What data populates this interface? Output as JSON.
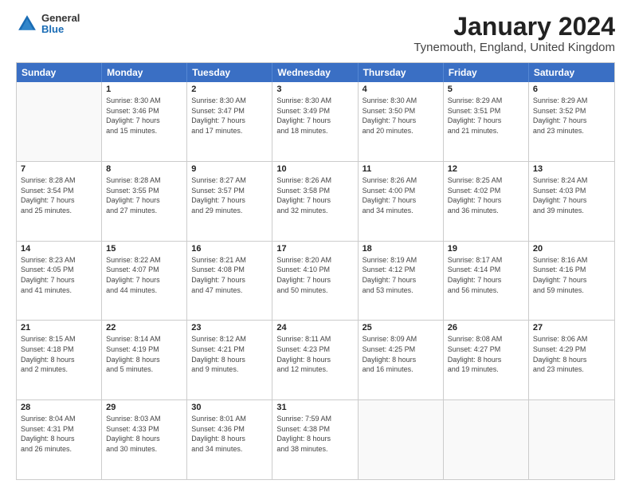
{
  "logo": {
    "general": "General",
    "blue": "Blue"
  },
  "title": "January 2024",
  "location": "Tynemouth, England, United Kingdom",
  "days_of_week": [
    "Sunday",
    "Monday",
    "Tuesday",
    "Wednesday",
    "Thursday",
    "Friday",
    "Saturday"
  ],
  "weeks": [
    [
      {
        "day": "",
        "info": ""
      },
      {
        "day": "1",
        "info": "Sunrise: 8:30 AM\nSunset: 3:46 PM\nDaylight: 7 hours\nand 15 minutes."
      },
      {
        "day": "2",
        "info": "Sunrise: 8:30 AM\nSunset: 3:47 PM\nDaylight: 7 hours\nand 17 minutes."
      },
      {
        "day": "3",
        "info": "Sunrise: 8:30 AM\nSunset: 3:49 PM\nDaylight: 7 hours\nand 18 minutes."
      },
      {
        "day": "4",
        "info": "Sunrise: 8:30 AM\nSunset: 3:50 PM\nDaylight: 7 hours\nand 20 minutes."
      },
      {
        "day": "5",
        "info": "Sunrise: 8:29 AM\nSunset: 3:51 PM\nDaylight: 7 hours\nand 21 minutes."
      },
      {
        "day": "6",
        "info": "Sunrise: 8:29 AM\nSunset: 3:52 PM\nDaylight: 7 hours\nand 23 minutes."
      }
    ],
    [
      {
        "day": "7",
        "info": "Sunrise: 8:28 AM\nSunset: 3:54 PM\nDaylight: 7 hours\nand 25 minutes."
      },
      {
        "day": "8",
        "info": "Sunrise: 8:28 AM\nSunset: 3:55 PM\nDaylight: 7 hours\nand 27 minutes."
      },
      {
        "day": "9",
        "info": "Sunrise: 8:27 AM\nSunset: 3:57 PM\nDaylight: 7 hours\nand 29 minutes."
      },
      {
        "day": "10",
        "info": "Sunrise: 8:26 AM\nSunset: 3:58 PM\nDaylight: 7 hours\nand 32 minutes."
      },
      {
        "day": "11",
        "info": "Sunrise: 8:26 AM\nSunset: 4:00 PM\nDaylight: 7 hours\nand 34 minutes."
      },
      {
        "day": "12",
        "info": "Sunrise: 8:25 AM\nSunset: 4:02 PM\nDaylight: 7 hours\nand 36 minutes."
      },
      {
        "day": "13",
        "info": "Sunrise: 8:24 AM\nSunset: 4:03 PM\nDaylight: 7 hours\nand 39 minutes."
      }
    ],
    [
      {
        "day": "14",
        "info": "Sunrise: 8:23 AM\nSunset: 4:05 PM\nDaylight: 7 hours\nand 41 minutes."
      },
      {
        "day": "15",
        "info": "Sunrise: 8:22 AM\nSunset: 4:07 PM\nDaylight: 7 hours\nand 44 minutes."
      },
      {
        "day": "16",
        "info": "Sunrise: 8:21 AM\nSunset: 4:08 PM\nDaylight: 7 hours\nand 47 minutes."
      },
      {
        "day": "17",
        "info": "Sunrise: 8:20 AM\nSunset: 4:10 PM\nDaylight: 7 hours\nand 50 minutes."
      },
      {
        "day": "18",
        "info": "Sunrise: 8:19 AM\nSunset: 4:12 PM\nDaylight: 7 hours\nand 53 minutes."
      },
      {
        "day": "19",
        "info": "Sunrise: 8:17 AM\nSunset: 4:14 PM\nDaylight: 7 hours\nand 56 minutes."
      },
      {
        "day": "20",
        "info": "Sunrise: 8:16 AM\nSunset: 4:16 PM\nDaylight: 7 hours\nand 59 minutes."
      }
    ],
    [
      {
        "day": "21",
        "info": "Sunrise: 8:15 AM\nSunset: 4:18 PM\nDaylight: 8 hours\nand 2 minutes."
      },
      {
        "day": "22",
        "info": "Sunrise: 8:14 AM\nSunset: 4:19 PM\nDaylight: 8 hours\nand 5 minutes."
      },
      {
        "day": "23",
        "info": "Sunrise: 8:12 AM\nSunset: 4:21 PM\nDaylight: 8 hours\nand 9 minutes."
      },
      {
        "day": "24",
        "info": "Sunrise: 8:11 AM\nSunset: 4:23 PM\nDaylight: 8 hours\nand 12 minutes."
      },
      {
        "day": "25",
        "info": "Sunrise: 8:09 AM\nSunset: 4:25 PM\nDaylight: 8 hours\nand 16 minutes."
      },
      {
        "day": "26",
        "info": "Sunrise: 8:08 AM\nSunset: 4:27 PM\nDaylight: 8 hours\nand 19 minutes."
      },
      {
        "day": "27",
        "info": "Sunrise: 8:06 AM\nSunset: 4:29 PM\nDaylight: 8 hours\nand 23 minutes."
      }
    ],
    [
      {
        "day": "28",
        "info": "Sunrise: 8:04 AM\nSunset: 4:31 PM\nDaylight: 8 hours\nand 26 minutes."
      },
      {
        "day": "29",
        "info": "Sunrise: 8:03 AM\nSunset: 4:33 PM\nDaylight: 8 hours\nand 30 minutes."
      },
      {
        "day": "30",
        "info": "Sunrise: 8:01 AM\nSunset: 4:36 PM\nDaylight: 8 hours\nand 34 minutes."
      },
      {
        "day": "31",
        "info": "Sunrise: 7:59 AM\nSunset: 4:38 PM\nDaylight: 8 hours\nand 38 minutes."
      },
      {
        "day": "",
        "info": ""
      },
      {
        "day": "",
        "info": ""
      },
      {
        "day": "",
        "info": ""
      }
    ]
  ]
}
